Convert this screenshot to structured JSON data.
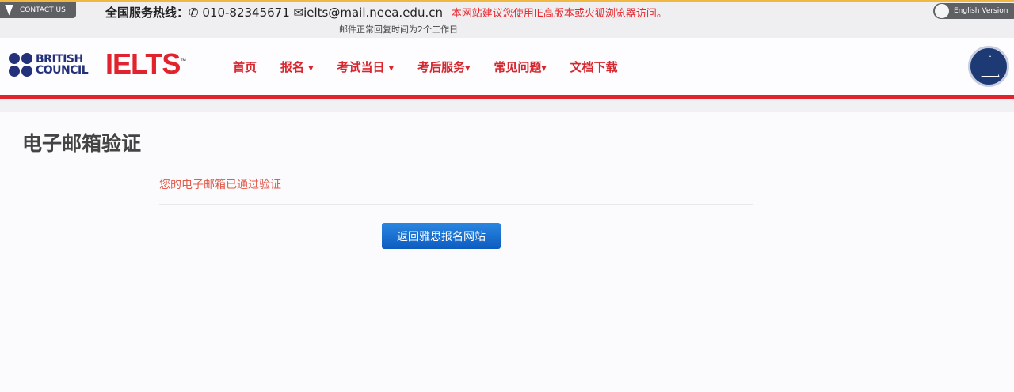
{
  "topbar": {
    "contact_label": "CONTACT US",
    "hotline_label": "全国服务热线：",
    "phone": "010-82345671",
    "email": "ielts@mail.neea.edu.cn",
    "browser_notice": "本网站建议您使用IE高版本或火狐浏览器访问。",
    "reply_note": "邮件正常回复时间为2个工作日",
    "english_version": "English Version"
  },
  "brand": {
    "british_council_line1": "BRITISH",
    "british_council_line2": "COUNCIL",
    "ielts": "IELTS",
    "tm": "™"
  },
  "nav": [
    {
      "label": "首页",
      "dropdown": false
    },
    {
      "label": "报名",
      "dropdown": true
    },
    {
      "label": "考试当日",
      "dropdown": true
    },
    {
      "label": "考后服务",
      "dropdown": true
    },
    {
      "label": "常见问题",
      "dropdown": true
    },
    {
      "label": "文档下载",
      "dropdown": false
    }
  ],
  "main": {
    "title": "电子邮箱验证",
    "message": "您的电子邮箱已通过验证",
    "return_button": "返回雅思报名网站"
  },
  "colors": {
    "accent_red": "#e0232c",
    "button_blue": "#1a6fd0",
    "brand_navy": "#23307a"
  }
}
